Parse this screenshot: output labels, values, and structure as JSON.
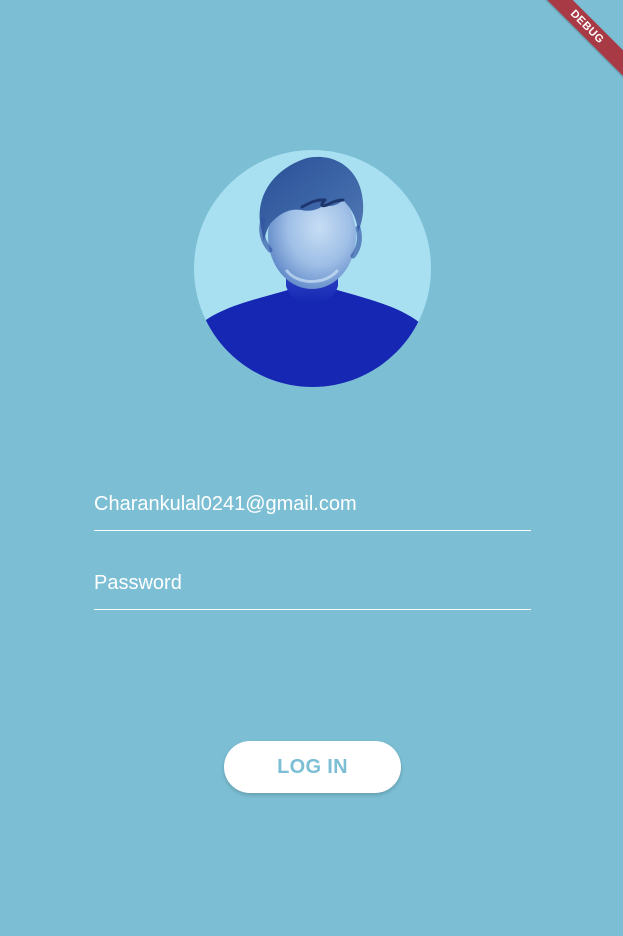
{
  "debug_banner": {
    "label": "DEBUG"
  },
  "avatar": {
    "icon": "user-avatar-icon"
  },
  "form": {
    "email_value": "Charankulal0241@gmail.com",
    "password_placeholder": "Password"
  },
  "actions": {
    "login_label": "LOG IN"
  },
  "colors": {
    "background": "#7cbfd4",
    "avatar_bg": "#a8e0f2",
    "body": "#1628b3",
    "hair": "#2f4f90",
    "face": "#a7c8ea",
    "ribbon": "#a83a46",
    "button_text": "#7cbfd4"
  }
}
